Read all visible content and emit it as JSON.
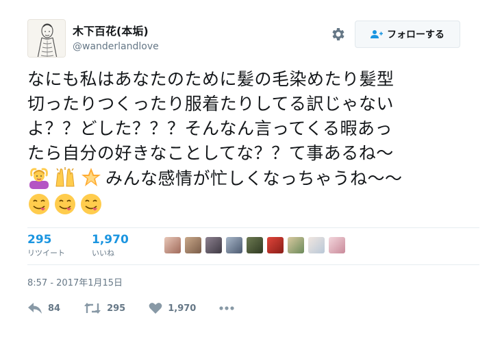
{
  "user": {
    "display_name": "木下百花(本垢)",
    "handle": "@wanderlandlove",
    "avatar_icon": "avatar-sketch-icon"
  },
  "header": {
    "settings_icon": "gear-icon",
    "follow_label": "フォローする",
    "follow_icon": "add-user-icon"
  },
  "tweet": {
    "lines": [
      "なにも私はあなたのために髪の毛染めたり髪型",
      "切ったりつくったり服着たりしてる訳じゃない",
      "よ？？どした？？？そんなん言ってくる暇あっ",
      "たら自分の好きなことしてな？？て事あるね～"
    ],
    "emoji_line_text": "みんな感情が忙しくなっちゃうね～～",
    "emojis_line5": [
      "person-gesturing-ok-emoji",
      "raising-hands-emoji",
      "glowing-star-emoji"
    ],
    "emojis_line6": [
      "savoring-food-emoji",
      "savoring-food-emoji",
      "savoring-food-emoji"
    ]
  },
  "stats": {
    "retweets_value": "295",
    "retweets_label": "リツイート",
    "likes_value": "1,970",
    "likes_label": "いいね",
    "liker_count": 9
  },
  "timestamp": "8:57 - 2017年1月15日",
  "actions": {
    "reply_count": "84",
    "retweet_count": "295",
    "like_count": "1,970",
    "reply_icon": "reply-icon",
    "retweet_icon": "retweet-icon",
    "like_icon": "heart-icon",
    "more_icon": "more-dots-icon"
  },
  "colors": {
    "accent": "#1b95e0",
    "muted": "#657786",
    "text": "#14171a",
    "divider": "#e6ecf0"
  }
}
